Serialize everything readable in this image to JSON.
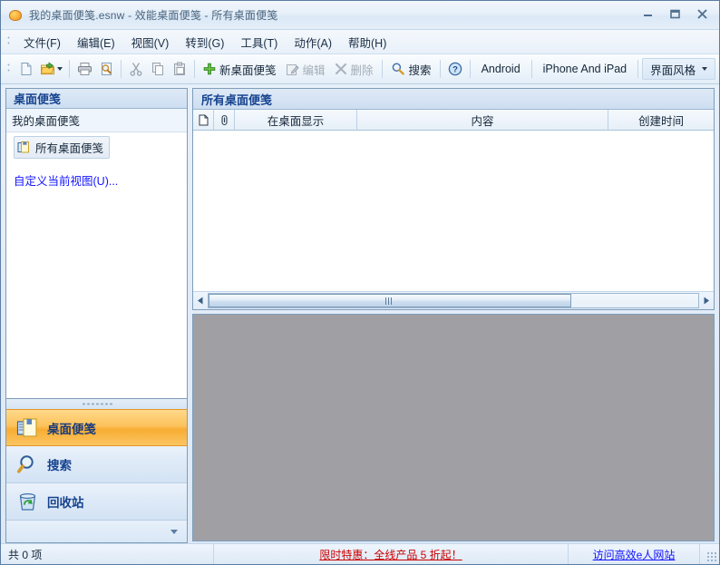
{
  "window": {
    "title": "我的桌面便笺.esnw - 效能桌面便笺 - 所有桌面便笺",
    "app_icon": "sticky-note-app-icon",
    "buttons": {
      "minimize": "minimize-icon",
      "maximize": "maximize-icon",
      "close": "close-icon"
    }
  },
  "menubar": {
    "items": [
      {
        "text": "文件(F)",
        "label": "文件",
        "accel": "F"
      },
      {
        "text": "编辑(E)",
        "label": "编辑",
        "accel": "E"
      },
      {
        "text": "视图(V)",
        "label": "视图",
        "accel": "V"
      },
      {
        "text": "转到(G)",
        "label": "转到",
        "accel": "G"
      },
      {
        "text": "工具(T)",
        "label": "工具",
        "accel": "T"
      },
      {
        "text": "动作(A)",
        "label": "动作",
        "accel": "A"
      },
      {
        "text": "帮助(H)",
        "label": "帮助",
        "accel": "H"
      }
    ]
  },
  "toolbar": {
    "new_icon": "new-document-icon",
    "open_icon": "open-folder-icon",
    "open_caret": "dropdown-caret",
    "print_icon": "print-icon",
    "print_preview_icon": "print-preview-icon",
    "cut_icon": "cut-icon",
    "copy_icon": "copy-icon",
    "paste_icon": "paste-icon",
    "new_note_label": "新桌面便笺",
    "edit_label": "编辑",
    "delete_label": "删除",
    "search_label": "搜索",
    "help_icon": "help-icon",
    "android_label": "Android",
    "iphone_label": "iPhone And iPad",
    "skin_label": "界面风格"
  },
  "sidebar": {
    "header": "桌面便笺",
    "group": "我的桌面便笺",
    "folder": {
      "label": "所有桌面便笺",
      "icon": "note-folder-icon"
    },
    "customize_link": "自定义当前视图(U)...",
    "nav_buttons": [
      {
        "label": "桌面便笺",
        "icon": "sticky-note-icon",
        "active": true
      },
      {
        "label": "搜索",
        "icon": "magnifier-icon",
        "active": false
      },
      {
        "label": "回收站",
        "icon": "recycle-bin-icon",
        "active": false
      }
    ]
  },
  "list": {
    "header": "所有桌面便笺",
    "columns": [
      {
        "key": "doc",
        "label": "",
        "icon": "document-icon"
      },
      {
        "key": "clip",
        "label": "",
        "icon": "paperclip-icon"
      },
      {
        "key": "show",
        "label": "在桌面显示"
      },
      {
        "key": "content",
        "label": "内容"
      },
      {
        "key": "time",
        "label": "创建时间"
      }
    ],
    "rows": [],
    "scroll": {
      "left_arrow": "scroll-left-arrow",
      "right_arrow": "scroll-right-arrow",
      "thumb_grip": "scroll-thumb-grip"
    }
  },
  "statusbar": {
    "count": "共 0 项",
    "promo": "限时特惠：全线产品 5 折起！",
    "visit": "访问高效e人网站",
    "resize_grip": "resize-grip-icon"
  },
  "colors": {
    "accent_orange": "#f8ad33",
    "header_blue": "#16438f",
    "link_blue": "#1414ff",
    "promo_red": "#cc0000",
    "preview_gray": "#a0a0a4",
    "border_blue": "#7f9db9"
  }
}
